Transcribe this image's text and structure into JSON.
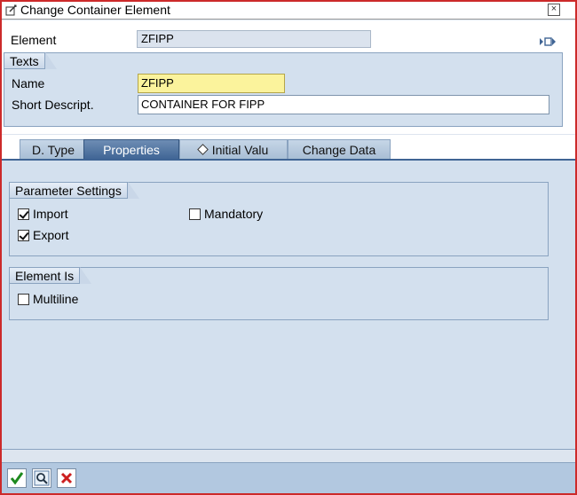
{
  "window": {
    "title": "Change Container Element",
    "close_label": "×"
  },
  "element": {
    "label": "Element",
    "value": "ZFIPP"
  },
  "texts": {
    "group_title": "Texts",
    "name_label": "Name",
    "name_value": "ZFIPP",
    "short_desc_label": "Short Descript.",
    "short_desc_value": "CONTAINER FOR FIPP"
  },
  "tabs": [
    {
      "label": "D. Type",
      "active": false
    },
    {
      "label": "Properties",
      "active": true
    },
    {
      "label": "Initial Valu",
      "active": false
    },
    {
      "label": "Change Data",
      "active": false
    }
  ],
  "parameter_settings": {
    "title": "Parameter Settings",
    "import_label": "Import",
    "import_checked": true,
    "export_label": "Export",
    "export_checked": true,
    "mandatory_label": "Mandatory",
    "mandatory_checked": false
  },
  "element_is": {
    "title": "Element Is",
    "multiline_label": "Multiline",
    "multiline_checked": false
  },
  "toolbar": {
    "ok_icon": "checkmark-icon",
    "search_icon": "magnifier-icon",
    "cancel_icon": "cancel-x-icon"
  },
  "colors": {
    "accent": "#3f6494",
    "panel": "#d3e0ee",
    "active_input": "#fbf39c"
  }
}
